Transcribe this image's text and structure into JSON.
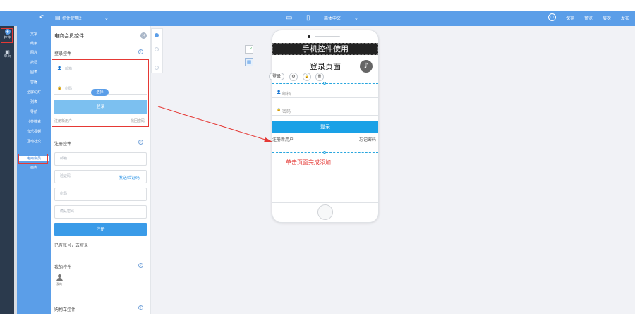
{
  "topbar": {
    "back_icon": "↶",
    "doc_icon": "▤",
    "doc_name": "控件使用2",
    "dropdown_icon": "⌄",
    "desktop_icon": "▭",
    "mobile_icon": "▯",
    "lang": "简体中文",
    "lang_arrow": "⌄",
    "more_icon": "⋯",
    "save": "保存",
    "preview": "预览",
    "layer": "层次",
    "publish": "发布"
  },
  "rail": {
    "add_label": "控件",
    "add_icon": "+",
    "page_label": "单页",
    "page_icon": "▣"
  },
  "categories": [
    "文字",
    "线条",
    "图片",
    "按钮",
    "图表",
    "容器",
    "全屏幻灯",
    "列表",
    "导航",
    "分类搜索",
    "音乐视频",
    "互动社交",
    "电商会员",
    "画廊"
  ],
  "panel": {
    "title": "电商会员控件",
    "close_icon": "×",
    "login_section": "登录控件",
    "help_icon": "?",
    "email_ph": "邮箱",
    "password_ph": "密码",
    "user_icon": "👤",
    "lock_icon": "🔒",
    "choose": "选择",
    "login_btn": "登录",
    "register_new": "注册新用户",
    "forgot": "找回密码",
    "register_section": "注册控件",
    "reg_email_ph": "邮箱",
    "verify_ph": "验证码",
    "send_code": "发送验证码",
    "reg_password_ph": "密码",
    "confirm_ph": "确认密码",
    "register_btn": "注册",
    "have_account": "已有账号，去登录",
    "my_section": "我的控件",
    "my_label": "我的",
    "cart_section": "购物车控件"
  },
  "side_icons": [
    "✓",
    "▦"
  ],
  "phone": {
    "header": "手机控件使用",
    "page_title": "登录页面",
    "music_icon": "♪",
    "tag": "登录",
    "gear_icon": "⚙",
    "unlock_icon": "🔓",
    "trash_icon": "🗑",
    "email_ph": "邮箱",
    "password_ph": "密码",
    "login_btn": "登录",
    "register_new": "注册新用户",
    "forgot": "忘记密码",
    "annotation": "单击页面完成添加"
  },
  "colors": {
    "accent": "#5b9ee8",
    "button": "#1aa1e6",
    "annotation": "#e53935"
  }
}
